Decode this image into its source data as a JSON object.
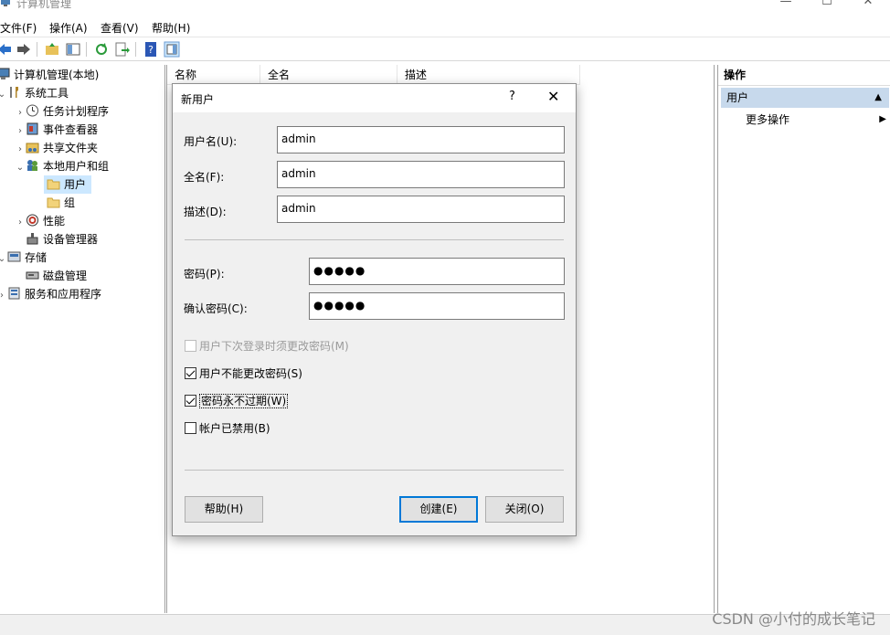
{
  "window": {
    "title": "计算机管理",
    "controls": [
      "—",
      "☐",
      "✕"
    ]
  },
  "menu": [
    "文件(F)",
    "操作(A)",
    "查看(V)",
    "帮助(H)"
  ],
  "tree": [
    {
      "label": "计算机管理(本地)"
    },
    {
      "label": "系统工具"
    },
    {
      "label": "任务计划程序"
    },
    {
      "label": "事件查看器"
    },
    {
      "label": "共享文件夹"
    },
    {
      "label": "本地用户和组"
    },
    {
      "label": "用户"
    },
    {
      "label": "组"
    },
    {
      "label": "性能"
    },
    {
      "label": "设备管理器"
    },
    {
      "label": "存储"
    },
    {
      "label": "磁盘管理"
    },
    {
      "label": "服务和应用程序"
    }
  ],
  "columns": [
    "名称",
    "全名",
    "描述"
  ],
  "actions": {
    "title": "操作",
    "section": "用户",
    "more": "更多操作"
  },
  "dialog": {
    "title": "新用户",
    "help_glyph": "?",
    "close_glyph": "✕",
    "username_label": "用户名(U):",
    "username_value": "admin",
    "fullname_label": "全名(F):",
    "fullname_value": "admin",
    "desc_label": "描述(D):",
    "desc_value": "admin",
    "password_label": "密码(P):",
    "password_value": "●●●●●",
    "confirm_label": "确认密码(C):",
    "confirm_value": "●●●●●",
    "options": [
      {
        "label": "用户下次登录时须更改密码(M)",
        "checked": false,
        "enabled": false
      },
      {
        "label": "用户不能更改密码(S)",
        "checked": true,
        "enabled": true
      },
      {
        "label": "密码永不过期(W)",
        "checked": true,
        "enabled": true
      },
      {
        "label": "帐户已禁用(B)",
        "checked": false,
        "enabled": true
      }
    ],
    "help_button": "帮助(H)",
    "create_button": "创建(E)",
    "close_button": "关闭(O)"
  },
  "watermark": "CSDN @小付的成长笔记",
  "colors": {
    "selection": "#cce8ff",
    "action_header": "#c7d9ec",
    "default_button_border": "#0078d7"
  }
}
